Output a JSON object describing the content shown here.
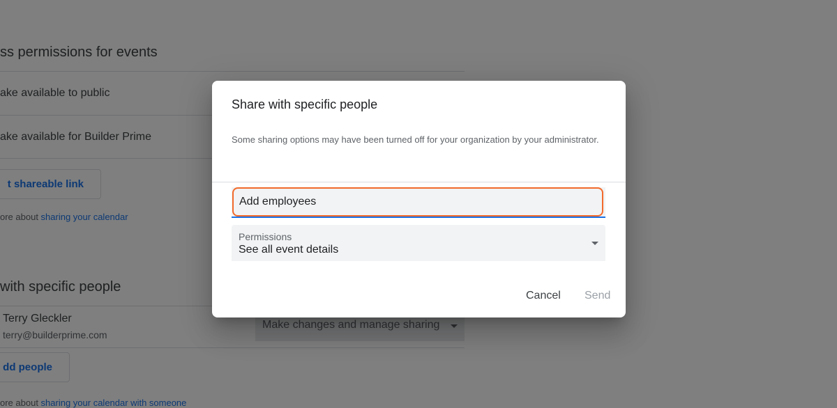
{
  "background": {
    "section1_title": "ss permissions for events",
    "make_public_label": "ake available to public",
    "make_org_label": "ake available for Builder Prime",
    "shareable_link_button": "t shareable link",
    "learn_more_prefix_1": "ore about ",
    "learn_more_link_1": "sharing your calendar",
    "section2_title": " with specific people",
    "person_name": "Terry Gleckler",
    "person_email": "terry@builderprime.com",
    "person_permission": "Make changes and manage sharing",
    "add_people_button": "dd people",
    "learn_more_prefix_2": "ore about ",
    "learn_more_link_2": "sharing your calendar with someone"
  },
  "dialog": {
    "title": "Share with specific people",
    "note": "Some sharing options may have been turned off for your organization by your administrator.",
    "add_input_value": "Add employees",
    "permissions_label": "Permissions",
    "permissions_value": "See all event details",
    "cancel_label": "Cancel",
    "send_label": "Send"
  },
  "colors": {
    "accent": "#1a73e8",
    "focus_outline": "#f26a2b",
    "scrim": "rgba(0,0,0,0.5)"
  }
}
